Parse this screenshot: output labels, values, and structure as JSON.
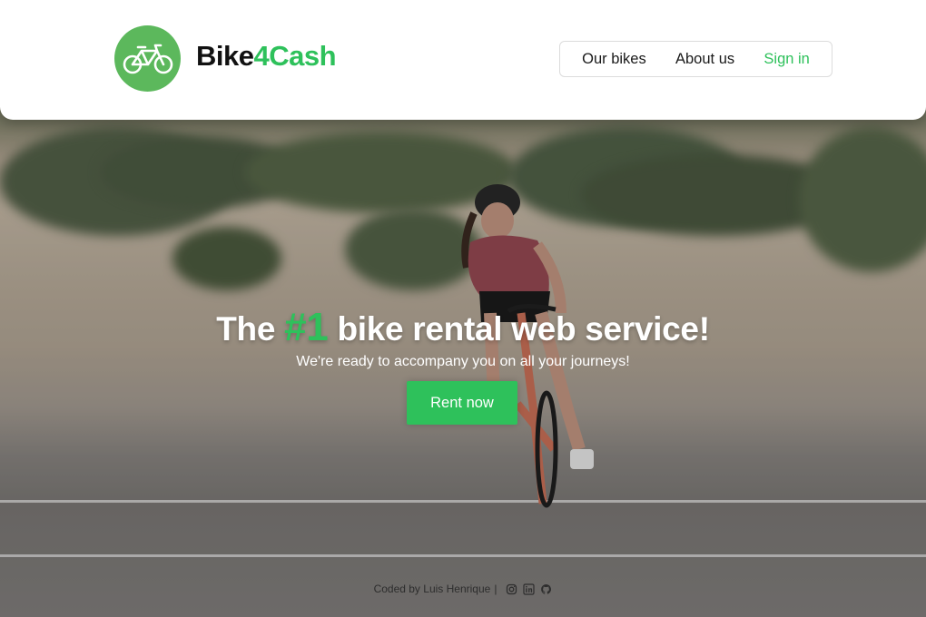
{
  "brand": {
    "name_main": "Bike",
    "name_accent": "4Cash",
    "logo_icon": "bicycle-icon",
    "logo_bg_color": "#5cb85c",
    "accent_color": "#2ec15b"
  },
  "nav": {
    "items": [
      {
        "label": "Our bikes"
      },
      {
        "label": "About us"
      },
      {
        "label": "Sign in"
      }
    ]
  },
  "hero": {
    "headline_pre": "The",
    "headline_num": "#1",
    "headline_post": "bike rental web service!",
    "subheadline": "We're ready to accompany you on all your journeys!",
    "cta_label": "Rent now",
    "background": "cyclist riding on a coastal road in front of grassy sand dunes"
  },
  "footer": {
    "credit": "Coded by Luis Henrique",
    "separator": "|",
    "icons": [
      "instagram-icon",
      "linkedin-icon",
      "github-icon"
    ]
  }
}
